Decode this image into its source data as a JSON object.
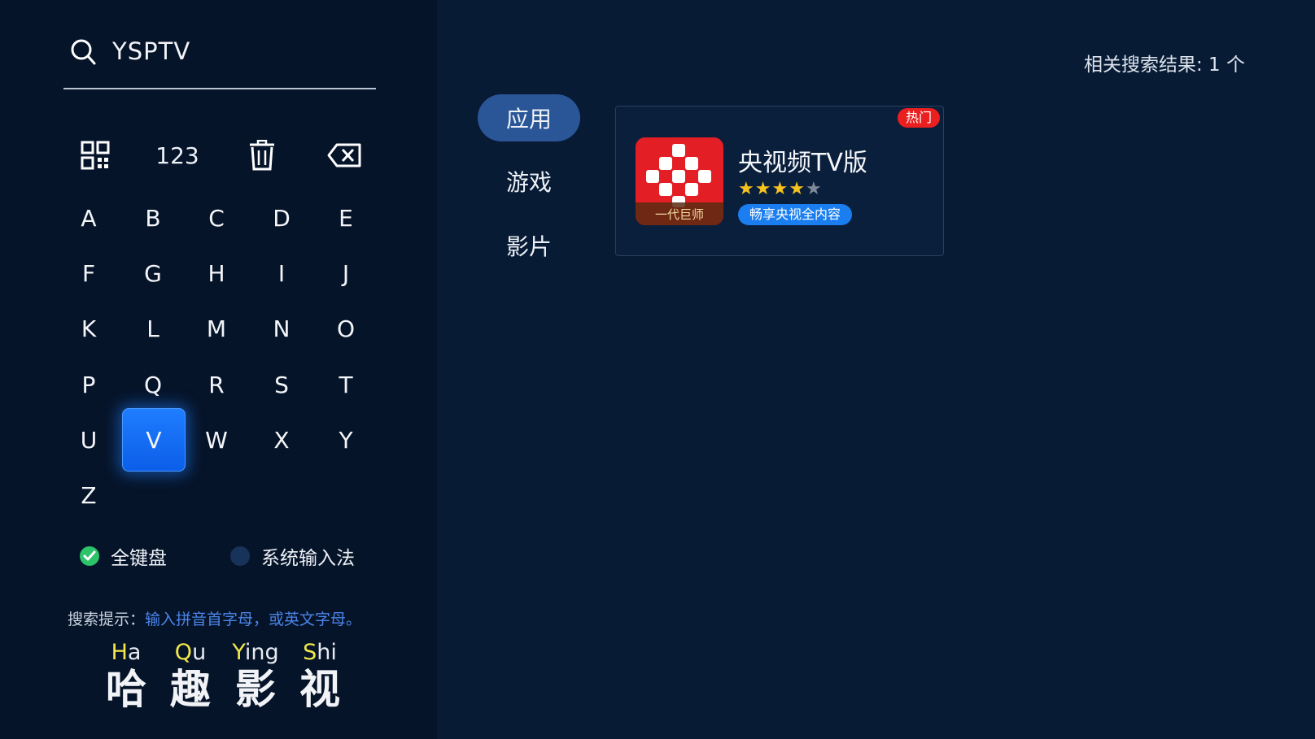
{
  "search": {
    "query": "YSPTV"
  },
  "toolbar": {
    "numbers_label": "123"
  },
  "keyboard": {
    "rows": [
      [
        "A",
        "B",
        "C",
        "D",
        "E"
      ],
      [
        "F",
        "G",
        "H",
        "I",
        "J"
      ],
      [
        "K",
        "L",
        "M",
        "N",
        "O"
      ],
      [
        "P",
        "Q",
        "R",
        "S",
        "T"
      ],
      [
        "U",
        "V",
        "W",
        "X",
        "Y"
      ],
      [
        "Z"
      ]
    ],
    "focused": "V"
  },
  "modes": {
    "full_keyboard": "全键盘",
    "system_input": "系统输入法",
    "selected": "full_keyboard"
  },
  "hint": {
    "label": "搜索提示：",
    "text": "输入拼音首字母，或英文字母。"
  },
  "brand": [
    {
      "initial": "H",
      "rest": "a",
      "char": "哈"
    },
    {
      "initial": "Q",
      "rest": "u",
      "char": "趣"
    },
    {
      "initial": "Y",
      "rest": "ing",
      "char": "影"
    },
    {
      "initial": "S",
      "rest": "hi",
      "char": "视"
    }
  ],
  "results": {
    "count_text": "相关搜索结果: 1 个"
  },
  "categories": [
    {
      "label": "应用",
      "active": true
    },
    {
      "label": "游戏",
      "active": false
    },
    {
      "label": "影片",
      "active": false
    }
  ],
  "app_card": {
    "badge": "热门",
    "name": "央视频TV版",
    "rating": 4,
    "rating_max": 5,
    "tag": "畅享央视全内容",
    "icon_caption": "一代巨师"
  },
  "colors": {
    "background": "#081b35",
    "left_panel": "#061429",
    "focus_key": "#1f7dff",
    "active_tab": "#2a5698",
    "hot_badge": "#ea1f1f",
    "star": "#f6c21c",
    "pinyin_initial": "#f1e84a"
  }
}
